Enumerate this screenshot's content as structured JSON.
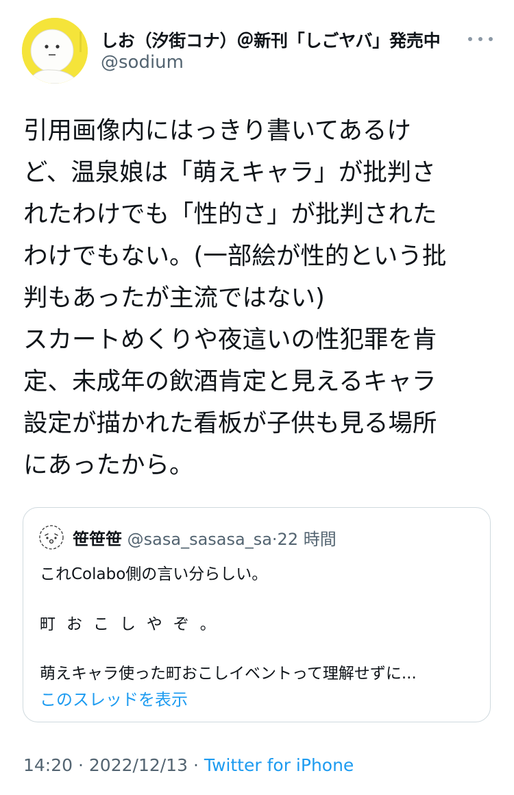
{
  "author": {
    "display_name": "しお（汐街コナ）＠新刊「しごヤバ」発売中",
    "handle": "@sodium"
  },
  "tweet": {
    "lines": [
      "引用画像内にはっきり書いてあるけ",
      "ど、温泉娘は「萌えキャラ」が批判さ",
      "れたわけでも「性的さ」が批判された",
      "わけでもない。(一部絵が性的という批",
      "判もあったが主流ではない)",
      "スカートめくりや夜這いの性犯罪を肯",
      "定、未成年の飲酒肯定と見えるキャラ",
      "設定が描かれた看板が子供も見る場所",
      "にあったから。"
    ]
  },
  "quote": {
    "name": "笹笹笹",
    "handle": "@sasa_sasasa_sa",
    "separator": "·",
    "time": "22 時間",
    "line1": "これColabo側の言い分らしい。",
    "line2": "町おこしやぞ。",
    "line3": "萌えキャラ使った町おこしイベントって理解せずに...",
    "show_thread": "このスレッドを表示"
  },
  "footer": {
    "time": "14:20",
    "dot1": "·",
    "date": "2022/12/13",
    "dot2": "·",
    "source": "Twitter for iPhone"
  },
  "icons": {
    "avatar": "cartoon-face-avatar",
    "more": "more-horizontal-icon",
    "quote_avatar": "smiley-face-avatar"
  },
  "colors": {
    "text": "#0f1419",
    "secondary": "#536471",
    "link": "#1d9bf0",
    "border": "#cfd9de",
    "avatar_bg": "#f5e43a"
  }
}
